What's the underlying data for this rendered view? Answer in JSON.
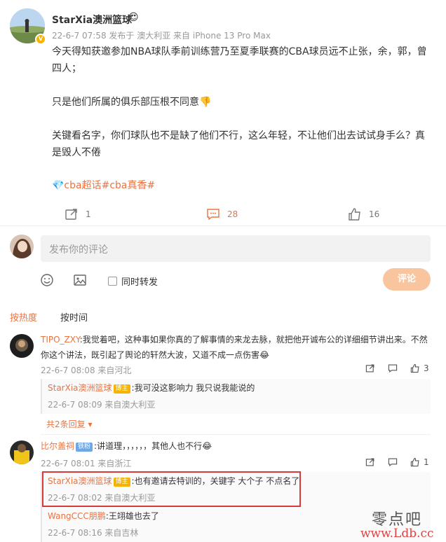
{
  "post": {
    "author": "StarXia澳洲篮球",
    "author_emoji": "😍",
    "meta": "22-6-7 07:58  发布于 澳大利亚  来自 iPhone 13 Pro Max",
    "paragraphs": [
      "今天得知获邀参加NBA球队季前训练营乃至夏季联赛的CBA球员远不止张，余，郭，曾四人；",
      "只是他们所属的俱乐部压根不同意👎",
      "关键看名字，你们球队也不是缺了他们不行，这么年轻，不让他们出去试试身手么？真是毁人不倦"
    ],
    "tags": "💎cba超话#cba真香#",
    "actions": {
      "repost_count": "1",
      "comment_count": "28",
      "like_count": "16"
    }
  },
  "compose": {
    "placeholder": "发布你的评论",
    "repost_label": "同时转发",
    "submit_label": "评论"
  },
  "sort": {
    "hot": "按热度",
    "time": "按时间"
  },
  "comments": [
    {
      "name": "TIPO_ZXY",
      "text": ":我觉着吧，这种事如果你真的了解事情的来龙去脉，就把他开诚布公的详细细节讲出来。不然你这个讲法，既引起了舆论的轩然大波，又道不成一点伤害😂",
      "meta": "22-6-7 08:08  来自河北",
      "likes": "3",
      "replies": [
        {
          "name": "StarXia澳洲篮球",
          "badge": "博主",
          "text": ":我可没这影响力 我只说我能说的",
          "meta": "22-6-7 08:09  来自澳大利亚"
        }
      ],
      "more": "共2条回复"
    },
    {
      "name": "比尔盖祠",
      "badge": "铁粉",
      "text": ":讲道理，，，，，，其他人也不行😂",
      "meta": "22-6-7 08:01  来自浙江",
      "likes": "1",
      "replies": [
        {
          "name": "StarXia澳洲篮球",
          "badge": "博主",
          "text": ":也有邀请去特训的，关键字 大个子 不点名了",
          "meta": "22-6-7 08:02  来自澳大利亚"
        },
        {
          "name": "WangCCC朋鹏",
          "text": ":王翊雄也去了",
          "meta": "22-6-7 08:16  来自吉林"
        }
      ]
    }
  ],
  "watermark": {
    "cn": "零点吧",
    "url": "www.Ldb.cc"
  },
  "colors": {
    "accent": "#eb7340",
    "submit_disabled": "#f8c59f",
    "highlight_box": "#d83a3a"
  }
}
